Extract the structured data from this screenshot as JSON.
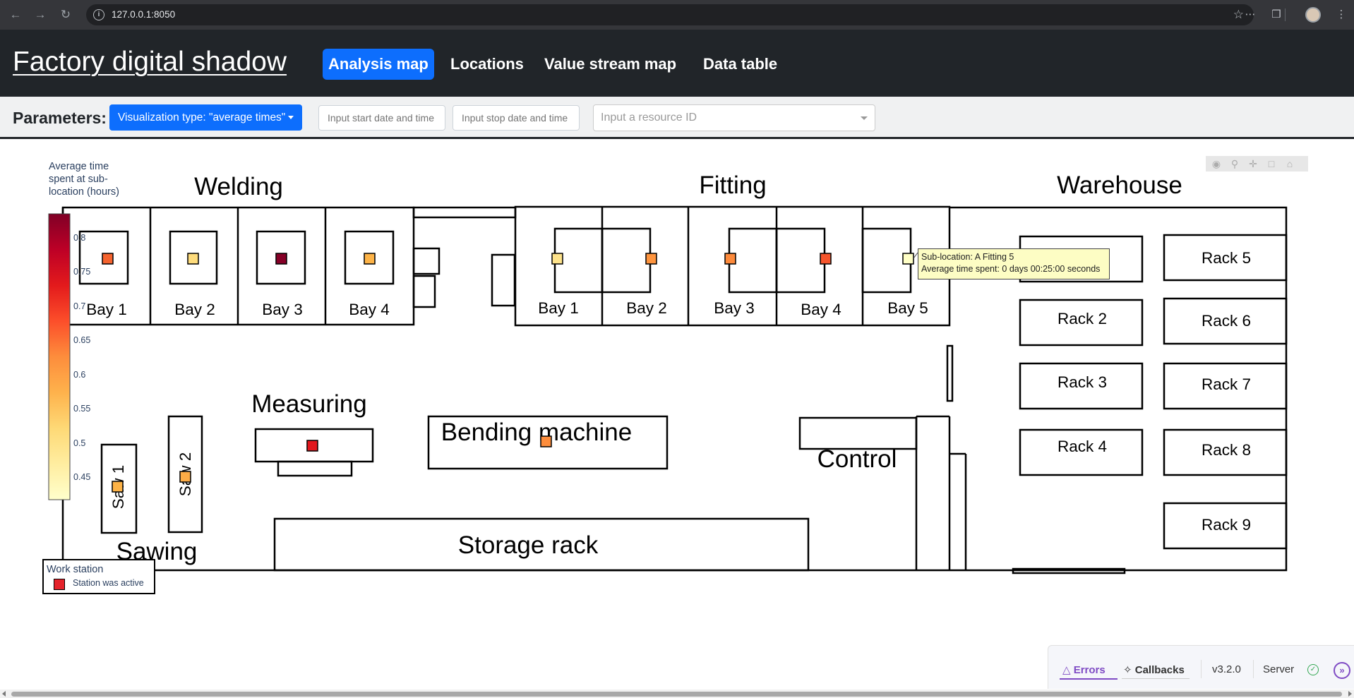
{
  "browser": {
    "url": "127.0.0.1:8050",
    "back_icon": "arrow-left-icon",
    "forward_icon": "arrow-right-icon",
    "reload_icon": "reload-icon"
  },
  "header": {
    "brand": "Factory digital shadow",
    "nav": [
      "Analysis map",
      "Locations",
      "Value stream map",
      "Data table"
    ],
    "active_nav": "Analysis map"
  },
  "parameters": {
    "label": "Parameters:",
    "visualization_button": "Visualization type: \"average times\"",
    "start_placeholder": "Input start date and time",
    "stop_placeholder": "Input stop date and time",
    "resource_placeholder": "Input a resource ID"
  },
  "map": {
    "areas": {
      "welding": "Welding",
      "fitting": "Fitting",
      "warehouse": "Warehouse",
      "measuring": "Measuring",
      "bending": "Bending machine",
      "control": "Control",
      "storage": "Storage rack",
      "sawing": "Sawing"
    },
    "welding_bays": [
      "Bay 1",
      "Bay 2",
      "Bay 3",
      "Bay 4"
    ],
    "fitting_bays": [
      "Bay 1",
      "Bay 2",
      "Bay 3",
      "Bay 4",
      "Bay 5"
    ],
    "racks": [
      "Rack 2",
      "Rack 3",
      "Rack 4",
      "Rack 5",
      "Rack 6",
      "Rack 7",
      "Rack 8",
      "Rack 9"
    ],
    "saws": [
      "Saw 1",
      "Saw 2"
    ]
  },
  "colorbar": {
    "title": "Average time spent at sub-location (hours)",
    "ticks": [
      "0.8",
      "0.75",
      "0.7",
      "0.65",
      "0.6",
      "0.55",
      "0.5",
      "0.45"
    ],
    "colors": [
      "#ffffcc",
      "#ffeda0",
      "#fed976",
      "#feb24c",
      "#fd8d3c",
      "#fc4e2a",
      "#e31a1c",
      "#bd0026",
      "#800026"
    ]
  },
  "markers": {
    "welding_bay1": "#f5632e",
    "welding_bay2": "#fedc7c",
    "welding_bay3": "#860027",
    "welding_bay4": "#fdb347",
    "fitting_bay1": "#fee38b",
    "fitting_bay2": "#fe943e",
    "fitting_bay3": "#fd8a3b",
    "fitting_bay4": "#f6552c",
    "fitting_bay5": "#ffffc6",
    "measuring": "#e2171d",
    "bending": "#fd8d3c",
    "saw1": "#fdb347",
    "saw2": "#fdac46"
  },
  "tooltip": {
    "line1": "Sub-location: A Fitting 5",
    "line2": "Average time spent: 0 days 00:25:00 seconds"
  },
  "legend": {
    "title": "Work station",
    "item": "Station was active",
    "color": "#e5232b"
  },
  "devtools": {
    "errors": "Errors",
    "callbacks": "Callbacks",
    "version": "v3.2.0",
    "server": "Server"
  }
}
